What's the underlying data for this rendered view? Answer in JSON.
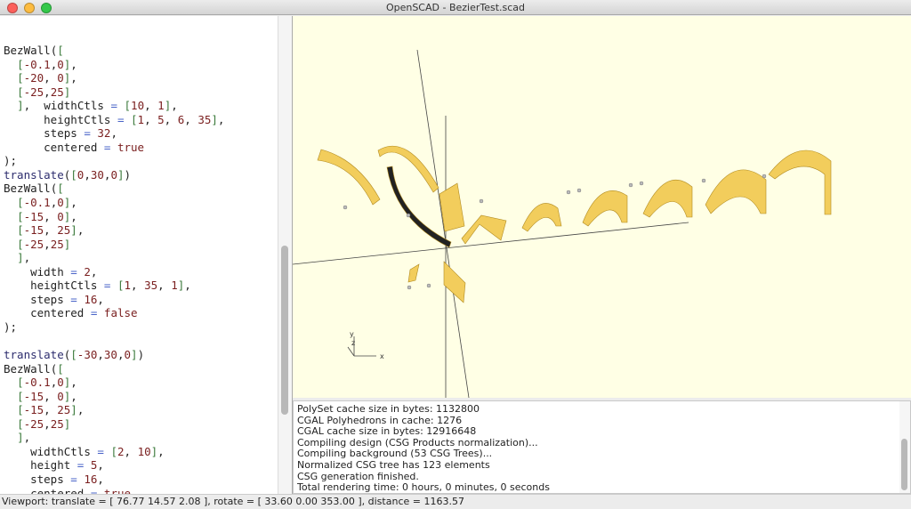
{
  "window": {
    "title": "OpenSCAD - BezierTest.scad"
  },
  "editor": {
    "lines": [
      "BezWall([",
      "  [-0.1,0],",
      "  [-20, 0],",
      "  [-25,25]",
      "  ],  widthCtls = [10, 1],",
      "      heightCtls = [1, 5, 6, 35],",
      "      steps = 32,",
      "      centered = true",
      ");",
      "translate([0,30,0])",
      "BezWall([",
      "  [-0.1,0],",
      "  [-15, 0],",
      "  [-15, 25],",
      "  [-25,25]",
      "  ],",
      "    width = 2,",
      "    heightCtls = [1, 35, 1],",
      "    steps = 16,",
      "    centered = false",
      ");",
      "",
      "translate([-30,30,0])",
      "BezWall([",
      "  [-0.1,0],",
      "  [-15, 0],",
      "  [-15, 25],",
      "  [-25,25]",
      "  ],",
      "    widthCtls = [2, 10],",
      "    height = 5,",
      "    steps = 16,",
      "    centered = true",
      ");"
    ]
  },
  "viewer": {
    "background": "#ffffe5",
    "model_color": "#f2cd5c",
    "axis_labels": {
      "x": "x",
      "y": "y",
      "z": "z"
    }
  },
  "console": {
    "messages": [
      "PolySet cache size in bytes: 1132800",
      "CGAL Polyhedrons in cache: 1276",
      "CGAL cache size in bytes: 12916648",
      "Compiling design (CSG Products normalization)...",
      "Compiling background (53 CSG Trees)...",
      "Normalized CSG tree has 123 elements",
      "CSG generation finished.",
      "Total rendering time: 0 hours, 0 minutes, 0 seconds"
    ]
  },
  "statusbar": {
    "text": "Viewport: translate = [ 76.77 14.57 2.08 ], rotate = [ 33.60 0.00 353.00 ], distance = 1163.57"
  }
}
